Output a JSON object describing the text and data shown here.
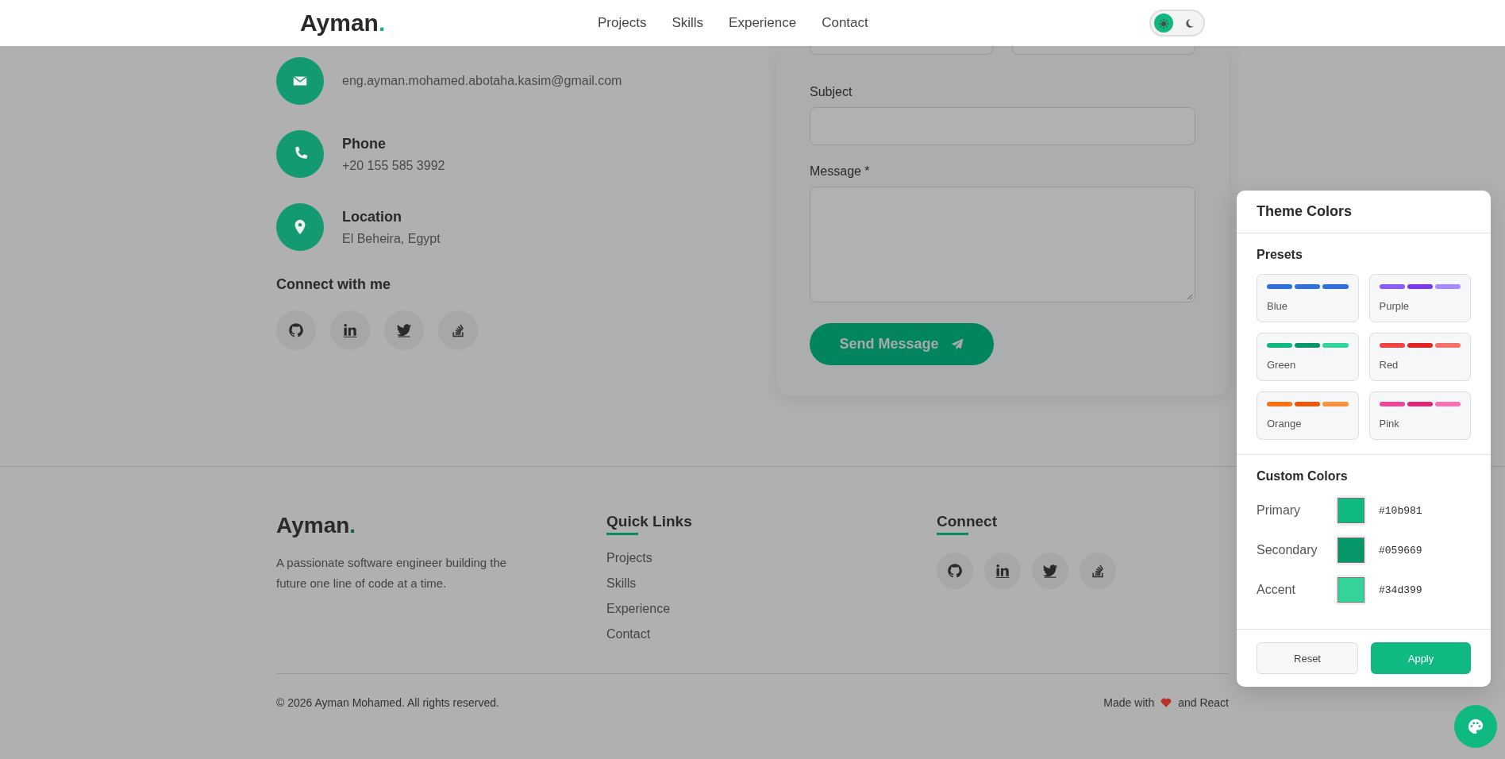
{
  "nav": {
    "logo": "Ayman",
    "logo_dot": ".",
    "links": [
      "Projects",
      "Skills",
      "Experience",
      "Contact"
    ],
    "theme_toggle": {
      "dark": false
    }
  },
  "contact": {
    "items": [
      {
        "kind": "email",
        "value": "eng.ayman.mohamed.abotaha.kasim@gmail.com"
      },
      {
        "kind": "phone",
        "title": "Phone",
        "value": "+20 155 585 3992"
      },
      {
        "kind": "location",
        "title": "Location",
        "value": "El Beheira, Egypt"
      }
    ],
    "connect_title": "Connect with me",
    "socials": [
      {
        "kind": "github"
      },
      {
        "kind": "linkedin"
      },
      {
        "kind": "twitter"
      },
      {
        "kind": "stackoverflow"
      }
    ]
  },
  "form": {
    "cut_fields": [
      {
        "kind": "input"
      },
      {
        "kind": "input"
      }
    ],
    "fields": [
      {
        "kind": "input",
        "label": "Subject"
      },
      {
        "kind": "textarea",
        "label": "Message *"
      }
    ],
    "submit": "Send Message"
  },
  "footer": {
    "logo": "Ayman",
    "logo_dot": ".",
    "tagline": "A passionate software engineer building the future one line of code at a time.",
    "quick_links_title": "Quick Links",
    "quick_links": [
      "Projects",
      "Skills",
      "Experience",
      "Contact"
    ],
    "connect_title": "Connect",
    "socials": [
      {
        "kind": "github"
      },
      {
        "kind": "linkedin"
      },
      {
        "kind": "twitter"
      },
      {
        "kind": "stackoverflow"
      }
    ],
    "copyright": "© 2026 Ayman Mohamed. All rights reserved.",
    "made_with": "Made with",
    "made_with_end": "and React"
  },
  "theme_panel": {
    "title": "Theme Colors",
    "presets_title": "Presets",
    "presets": [
      {
        "name": "Blue",
        "swatches": [
          {
            "color": "#2f6fde"
          },
          {
            "color": "#2f6fde"
          },
          {
            "color": "#2f6fde"
          }
        ]
      },
      {
        "name": "Purple",
        "swatches": [
          {
            "color": "#8b5cf6"
          },
          {
            "color": "#7c3aed"
          },
          {
            "color": "#a78bfa"
          }
        ]
      },
      {
        "name": "Green",
        "swatches": [
          {
            "color": "#10b981"
          },
          {
            "color": "#059669"
          },
          {
            "color": "#34d399"
          }
        ]
      },
      {
        "name": "Red",
        "swatches": [
          {
            "color": "#ef4444"
          },
          {
            "color": "#dc2626"
          },
          {
            "color": "#f87171"
          }
        ]
      },
      {
        "name": "Orange",
        "swatches": [
          {
            "color": "#f97316"
          },
          {
            "color": "#ea580c"
          },
          {
            "color": "#fb923c"
          }
        ]
      },
      {
        "name": "Pink",
        "swatches": [
          {
            "color": "#ec4899"
          },
          {
            "color": "#db2777"
          },
          {
            "color": "#f472b6"
          }
        ]
      }
    ],
    "custom_title": "Custom Colors",
    "custom": [
      {
        "label": "Primary",
        "color": "#10b981",
        "hex": "#10b981"
      },
      {
        "label": "Secondary",
        "color": "#059669",
        "hex": "#059669"
      },
      {
        "label": "Accent",
        "color": "#34d399",
        "hex": "#34d399"
      }
    ],
    "reset": "Reset",
    "apply": "Apply"
  }
}
